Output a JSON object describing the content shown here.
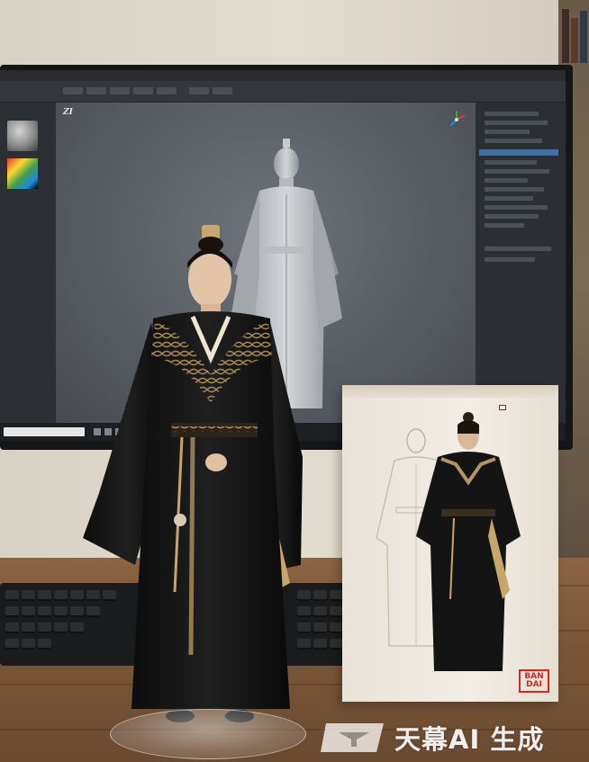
{
  "scene": {
    "description_visible": false
  },
  "monitor": {
    "app_logo": "ZI",
    "menu_items": [
      "",
      "",
      "",
      "",
      "",
      "",
      "",
      "",
      "",
      "",
      "",
      ""
    ]
  },
  "box": {
    "title_text": "",
    "sticker_text": "",
    "brand_logo": "BANDAI"
  },
  "watermark": {
    "text": "天幕AI 生成"
  },
  "colors": {
    "robe": "#121212",
    "gold_trim": "#c7a66a",
    "desk": "#7a5638",
    "brand_red": "#d7261e"
  }
}
